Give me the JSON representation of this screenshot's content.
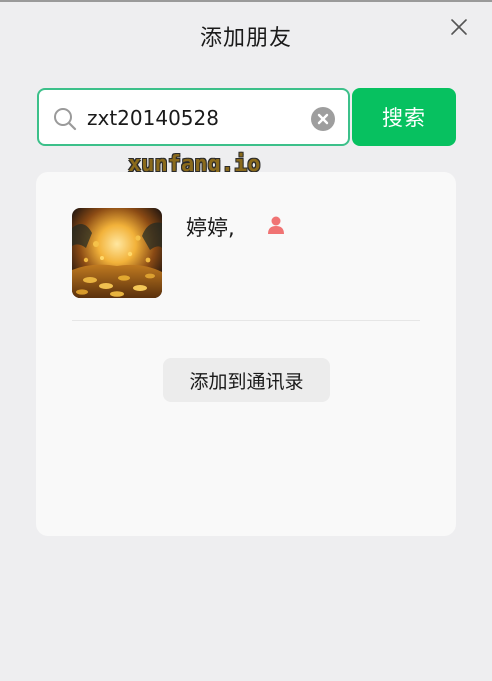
{
  "header": {
    "title": "添加朋友"
  },
  "search": {
    "value": "zxt20140528",
    "button_label": "搜索"
  },
  "watermark": {
    "text": "xunfang.io"
  },
  "result": {
    "name": "婷婷,",
    "gender": "female",
    "add_button_label": "添加到通讯录"
  },
  "colors": {
    "accent": "#07c160",
    "focus_border": "#3cc08a",
    "female_icon": "#f07373",
    "background": "#eeeef0",
    "card": "#f9f9f9"
  },
  "icons": [
    "close-icon",
    "search-icon",
    "clear-icon",
    "female-user-icon"
  ]
}
